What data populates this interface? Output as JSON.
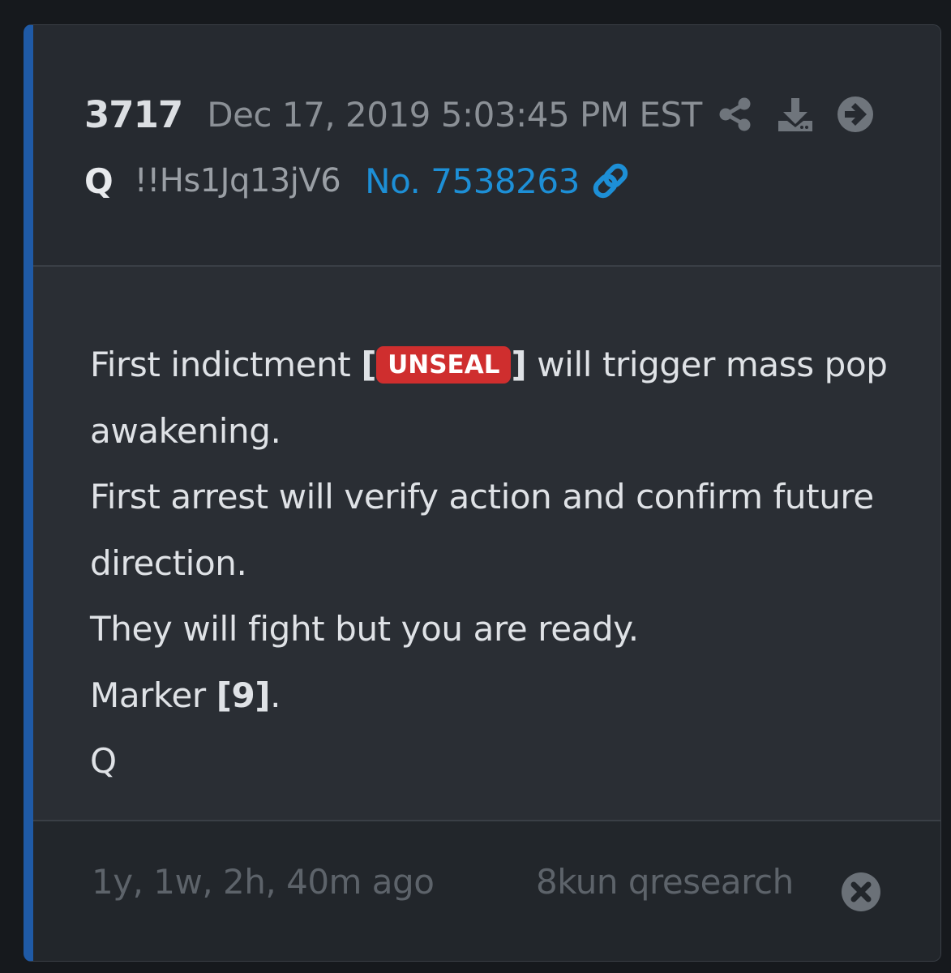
{
  "post": {
    "number": "3717",
    "date": "Dec 17, 2019 5:03:45 PM EST",
    "author": "Q",
    "tripcode": "!!Hs1Jq13jV6",
    "post_no": "No. 7538263",
    "body": {
      "line1_before": "First indictment ",
      "bracket_open": "[",
      "badge": "UNSEAL",
      "bracket_close": "]",
      "line1_after": " will trigger mass pop awakening.",
      "line2": "First arrest will verify action and confirm future direction.",
      "line3": "They will fight but you are ready.",
      "marker_prefix": "Marker ",
      "marker_value": "[9]",
      "marker_suffix": ".",
      "signature": "Q"
    },
    "age": "1y, 1w, 2h, 40m ago",
    "source": "8kun qresearch"
  },
  "icons": {
    "share": "share-icon",
    "download": "download-icon",
    "forward": "arrow-right-circle-icon",
    "link": "link-icon",
    "close": "close-circle-icon"
  },
  "colors": {
    "accent_border": "#1f5aa6",
    "link": "#1d8fd6",
    "badge": "#cf2e2e",
    "card_bg": "#2a2e34"
  }
}
